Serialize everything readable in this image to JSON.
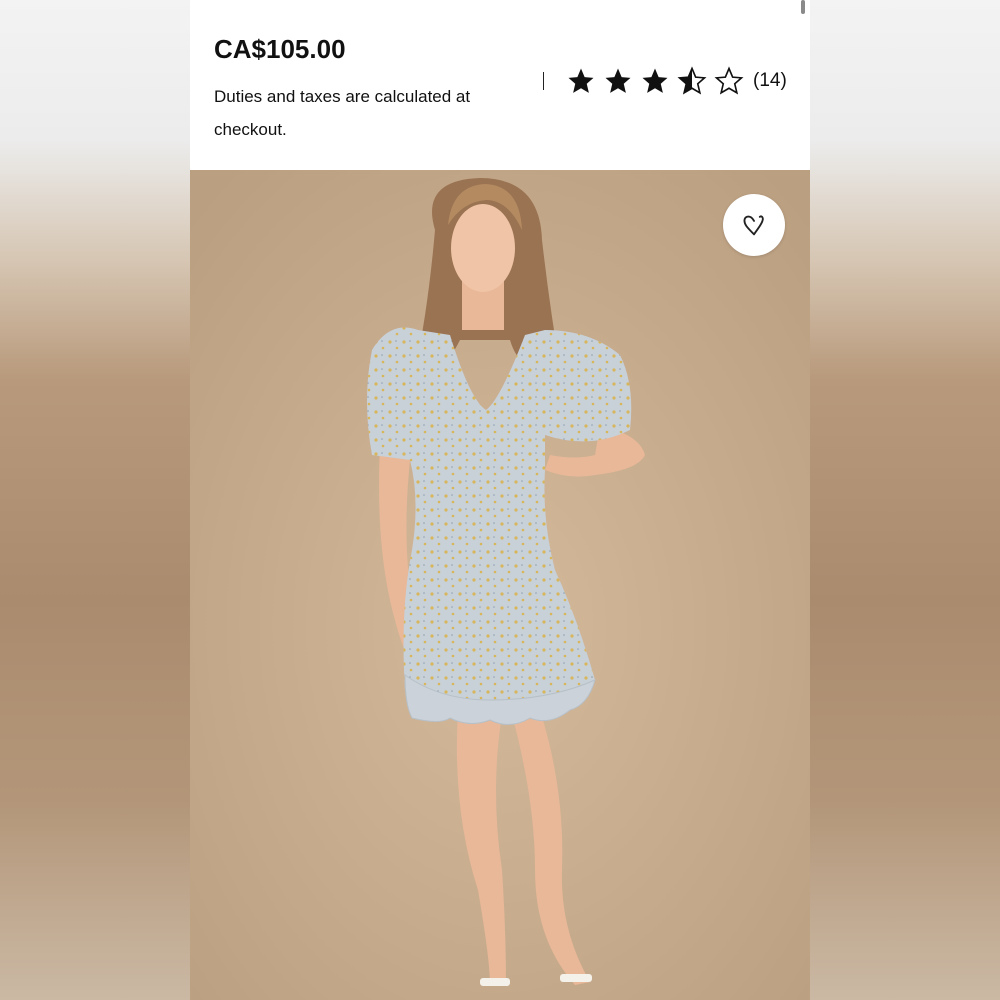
{
  "product": {
    "price": "CA$105.00",
    "duties_note": "Duties and taxes are calculated at checkout.",
    "rating": {
      "value": 3.5,
      "max": 5,
      "count_label": "(14)"
    }
  },
  "photo": {
    "subject": "model wearing floral mini dress",
    "favorite_icon": "heart-icon"
  },
  "colors": {
    "backdrop": "#c5a98c",
    "dress": "#c9d0d6",
    "text": "#111111"
  }
}
